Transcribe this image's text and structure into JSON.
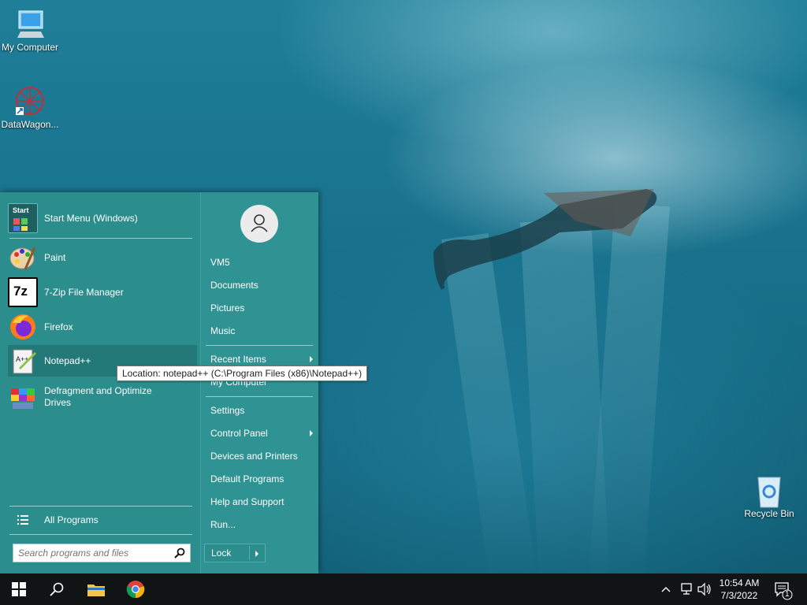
{
  "desktop": {
    "icons": [
      {
        "label": "My Computer",
        "icon": "computer-icon"
      },
      {
        "label": "DataWagon...",
        "icon": "datawagon-icon"
      },
      {
        "label": "Recycle Bin",
        "icon": "recycle-bin-icon"
      }
    ]
  },
  "start_menu": {
    "pinned": [
      {
        "label": "Start Menu (Windows)",
        "icon": "start-menu-icon"
      },
      {
        "label": "Paint",
        "icon": "paint-icon"
      },
      {
        "label": "7-Zip File Manager",
        "icon": "7zip-icon",
        "badge": "7z"
      },
      {
        "label": "Firefox",
        "icon": "firefox-icon"
      },
      {
        "label": "Notepad++",
        "icon": "notepadpp-icon"
      },
      {
        "label": "Defragment and Optimize Drives",
        "icon": "defrag-icon"
      }
    ],
    "all_programs": "All Programs",
    "search_placeholder": "Search programs and files",
    "right": {
      "user": "VM5",
      "items": [
        "Documents",
        "Pictures",
        "Music",
        "Recent Items",
        "My Computer",
        "Settings",
        "Control Panel",
        "Devices and Printers",
        "Default Programs",
        "Help and Support",
        "Run..."
      ],
      "lock": "Lock"
    },
    "tooltip": "Location: notepad++ (C:\\Program Files (x86)\\Notepad++)",
    "start_icon_text": "Start"
  },
  "taskbar": {
    "time": "10:54 AM",
    "date": "7/3/2022",
    "notification_count": "1"
  },
  "colors": {
    "menu_bg": "#2b8d8c",
    "menu_highlight": "#237978",
    "taskbar_bg": "#101414"
  }
}
